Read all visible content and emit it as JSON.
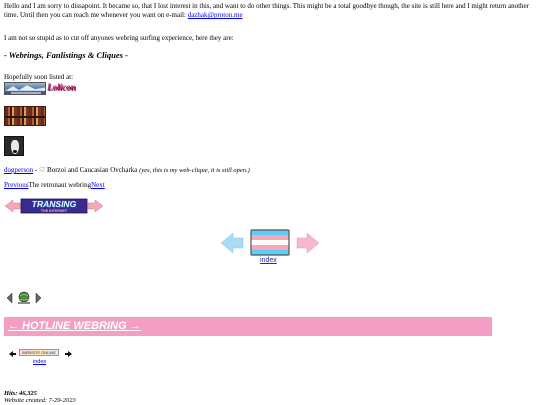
{
  "intro": {
    "text": "Hello and I am sorry to dissapoint. It became so, that I lost interest in this, and want to do other things. This might be a total goodbye though, the site is still here and I might return another time. Until then you can reach me whenever you want on e-mail:",
    "email": "dazhak@proton.me"
  },
  "intro2": "I am not so stupid as to cut off anyones webring surfing experience, here they are:",
  "heading": "- Webrings, Fanlistings & Cliques -",
  "soon_label": "Hopefully soon listed at:",
  "button_b_text": "Lolicon",
  "dog": {
    "link": "dogperson",
    "text": " - ♡ Borzoi and Caucasian Ovcharka ",
    "note": "(yes, this is my web-clique, it is still open.)"
  },
  "webring": {
    "previous": "Previous",
    "name": "The retronaut webring",
    "next": "Next"
  },
  "transing": {
    "line1": "TRANSING",
    "line2": "THE INTERNET"
  },
  "trans_index": "index",
  "hotline": {
    "text": "← HOTLINE WEBRING →",
    "color": "#f49ec4"
  },
  "mini_badge": "WEBSITE ONLINE",
  "mini_index": "index",
  "hits": "Hits: 46,325",
  "created": "Website created: 7-29-2023",
  "colors": {
    "trans_blue": "#5bcefa",
    "trans_pink": "#f5a9b8",
    "link": "#0000ee"
  }
}
